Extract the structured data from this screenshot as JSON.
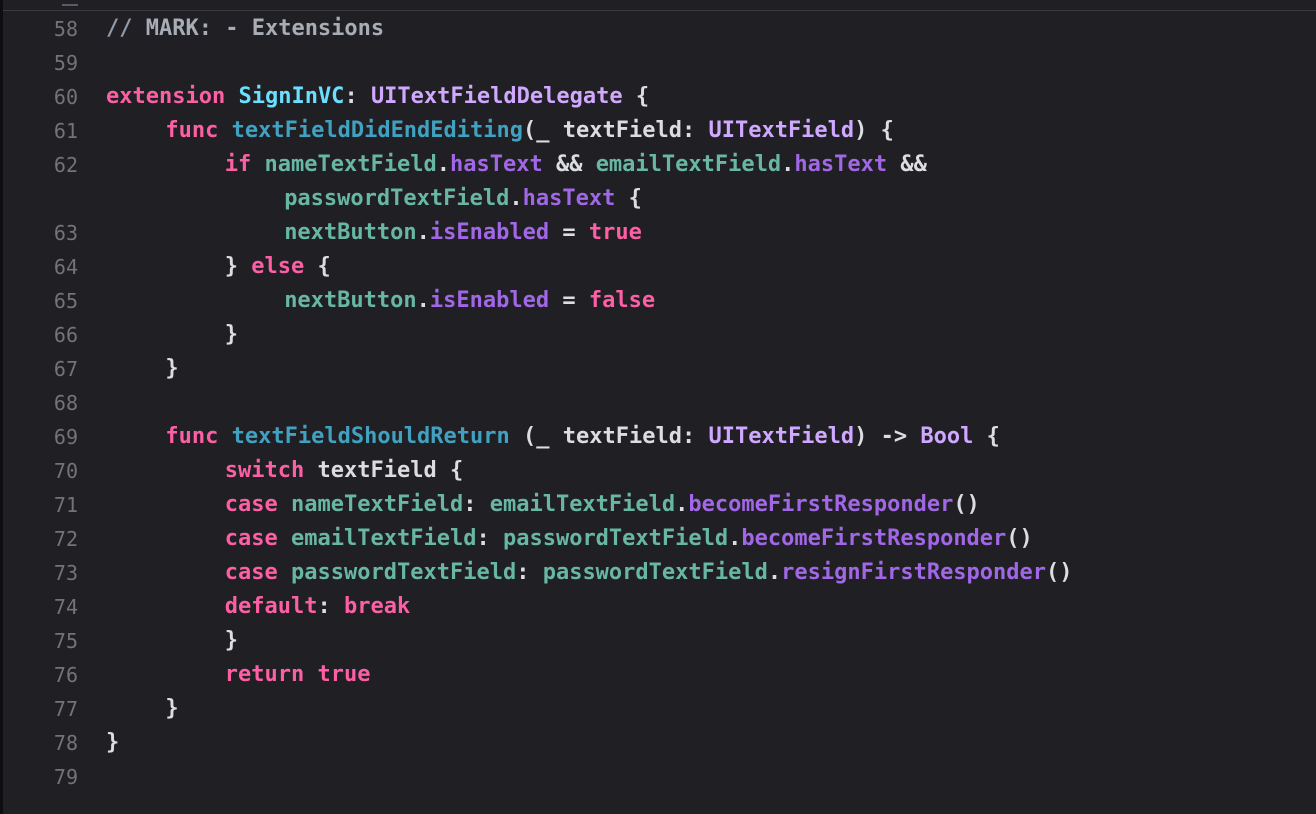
{
  "editor": {
    "lines": [
      {
        "n": "58",
        "indent": 0,
        "tokens": [
          {
            "t": "// ",
            "c": "comment"
          },
          {
            "t": "MARK: - Extensions",
            "c": "mark"
          }
        ]
      },
      {
        "n": "59",
        "indent": 0,
        "tokens": []
      },
      {
        "n": "60",
        "indent": 0,
        "tokens": [
          {
            "t": "extension",
            "c": "kw"
          },
          {
            "t": " ",
            "c": "plain"
          },
          {
            "t": "SignInVC",
            "c": "dtype"
          },
          {
            "t": ": ",
            "c": "plain"
          },
          {
            "t": "UITextFieldDelegate",
            "c": "type"
          },
          {
            "t": " {",
            "c": "plain"
          }
        ]
      },
      {
        "n": "61",
        "indent": 4,
        "tokens": [
          {
            "t": "func",
            "c": "kw"
          },
          {
            "t": " ",
            "c": "plain"
          },
          {
            "t": "textFieldDidEndEditing",
            "c": "func"
          },
          {
            "t": "(_ textField: ",
            "c": "plain"
          },
          {
            "t": "UITextField",
            "c": "type"
          },
          {
            "t": ") {",
            "c": "plain"
          }
        ]
      },
      {
        "n": "62",
        "indent": 8,
        "tokens": [
          {
            "t": "if",
            "c": "kw"
          },
          {
            "t": " ",
            "c": "plain"
          },
          {
            "t": "nameTextField",
            "c": "var"
          },
          {
            "t": ".",
            "c": "plain"
          },
          {
            "t": "hasText",
            "c": "prop"
          },
          {
            "t": " && ",
            "c": "plain"
          },
          {
            "t": "emailTextField",
            "c": "var"
          },
          {
            "t": ".",
            "c": "plain"
          },
          {
            "t": "hasText",
            "c": "prop"
          },
          {
            "t": " &&",
            "c": "plain"
          }
        ]
      },
      {
        "n": "",
        "indent": 12,
        "tokens": [
          {
            "t": "passwordTextField",
            "c": "var"
          },
          {
            "t": ".",
            "c": "plain"
          },
          {
            "t": "hasText",
            "c": "prop"
          },
          {
            "t": " {",
            "c": "plain"
          }
        ]
      },
      {
        "n": "63",
        "indent": 12,
        "tokens": [
          {
            "t": "nextButton",
            "c": "var"
          },
          {
            "t": ".",
            "c": "plain"
          },
          {
            "t": "isEnabled",
            "c": "prop"
          },
          {
            "t": " = ",
            "c": "plain"
          },
          {
            "t": "true",
            "c": "kw"
          }
        ]
      },
      {
        "n": "64",
        "indent": 8,
        "tokens": [
          {
            "t": "} ",
            "c": "plain"
          },
          {
            "t": "else",
            "c": "kw"
          },
          {
            "t": " {",
            "c": "plain"
          }
        ]
      },
      {
        "n": "65",
        "indent": 12,
        "tokens": [
          {
            "t": "nextButton",
            "c": "var"
          },
          {
            "t": ".",
            "c": "plain"
          },
          {
            "t": "isEnabled",
            "c": "prop"
          },
          {
            "t": " = ",
            "c": "plain"
          },
          {
            "t": "false",
            "c": "kw"
          }
        ]
      },
      {
        "n": "66",
        "indent": 8,
        "tokens": [
          {
            "t": "}",
            "c": "plain"
          }
        ]
      },
      {
        "n": "67",
        "indent": 4,
        "tokens": [
          {
            "t": "}",
            "c": "plain"
          }
        ]
      },
      {
        "n": "68",
        "indent": 0,
        "tokens": []
      },
      {
        "n": "69",
        "indent": 4,
        "tokens": [
          {
            "t": "func",
            "c": "kw"
          },
          {
            "t": " ",
            "c": "plain"
          },
          {
            "t": "textFieldShouldReturn",
            "c": "func"
          },
          {
            "t": " (_ textField: ",
            "c": "plain"
          },
          {
            "t": "UITextField",
            "c": "type"
          },
          {
            "t": ") -> ",
            "c": "plain"
          },
          {
            "t": "Bool",
            "c": "type"
          },
          {
            "t": " {",
            "c": "plain"
          }
        ]
      },
      {
        "n": "70",
        "indent": 8,
        "tokens": [
          {
            "t": "switch",
            "c": "kw"
          },
          {
            "t": " textField {",
            "c": "plain"
          }
        ]
      },
      {
        "n": "71",
        "indent": 8,
        "tokens": [
          {
            "t": "case",
            "c": "kw"
          },
          {
            "t": " ",
            "c": "plain"
          },
          {
            "t": "nameTextField",
            "c": "var"
          },
          {
            "t": ": ",
            "c": "plain"
          },
          {
            "t": "emailTextField",
            "c": "var"
          },
          {
            "t": ".",
            "c": "plain"
          },
          {
            "t": "becomeFirstResponder",
            "c": "prop"
          },
          {
            "t": "()",
            "c": "plain"
          }
        ]
      },
      {
        "n": "72",
        "indent": 8,
        "tokens": [
          {
            "t": "case",
            "c": "kw"
          },
          {
            "t": " ",
            "c": "plain"
          },
          {
            "t": "emailTextField",
            "c": "var"
          },
          {
            "t": ": ",
            "c": "plain"
          },
          {
            "t": "passwordTextField",
            "c": "var"
          },
          {
            "t": ".",
            "c": "plain"
          },
          {
            "t": "becomeFirstResponder",
            "c": "prop"
          },
          {
            "t": "()",
            "c": "plain"
          }
        ]
      },
      {
        "n": "73",
        "indent": 8,
        "tokens": [
          {
            "t": "case",
            "c": "kw"
          },
          {
            "t": " ",
            "c": "plain"
          },
          {
            "t": "passwordTextField",
            "c": "var"
          },
          {
            "t": ": ",
            "c": "plain"
          },
          {
            "t": "passwordTextField",
            "c": "var"
          },
          {
            "t": ".",
            "c": "plain"
          },
          {
            "t": "resignFirstResponder",
            "c": "prop"
          },
          {
            "t": "()",
            "c": "plain"
          }
        ]
      },
      {
        "n": "74",
        "indent": 8,
        "tokens": [
          {
            "t": "default",
            "c": "kw"
          },
          {
            "t": ": ",
            "c": "plain"
          },
          {
            "t": "break",
            "c": "kw"
          }
        ]
      },
      {
        "n": "75",
        "indent": 8,
        "tokens": [
          {
            "t": "}",
            "c": "plain"
          }
        ]
      },
      {
        "n": "76",
        "indent": 8,
        "tokens": [
          {
            "t": "return",
            "c": "kw"
          },
          {
            "t": " ",
            "c": "plain"
          },
          {
            "t": "true",
            "c": "kw"
          }
        ]
      },
      {
        "n": "77",
        "indent": 4,
        "tokens": [
          {
            "t": "}",
            "c": "plain"
          }
        ]
      },
      {
        "n": "78",
        "indent": 0,
        "tokens": [
          {
            "t": "}",
            "c": "plain"
          }
        ]
      },
      {
        "n": "79",
        "indent": 0,
        "tokens": []
      }
    ]
  },
  "colors": {
    "background": "#1f1f24",
    "keyword": "#fc5fa3",
    "type": "#d0a8ff",
    "declared_type": "#5dd8ff",
    "function_name": "#41a1c0",
    "property": "#a167e6",
    "variable": "#67b7a4",
    "plain": "#dcdde0",
    "comment": "#8f9aa6",
    "line_number": "#737378"
  }
}
